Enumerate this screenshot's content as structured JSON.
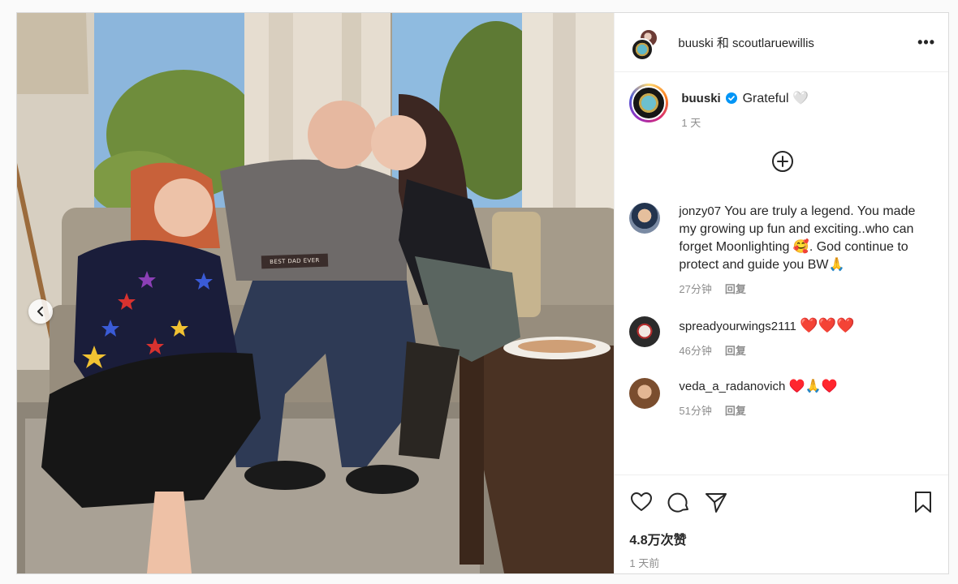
{
  "header": {
    "title": "buuski 和 scoutlaruewillis",
    "more_label": "•••"
  },
  "photo": {
    "tag_text": "BEST DAD EVER",
    "nav_prev_icon": "chevron-left-icon"
  },
  "caption": {
    "user": "buuski",
    "text": "Grateful 🤍",
    "time": "1 天",
    "verified_color": "#0095f6"
  },
  "comments": [
    {
      "user": "jonzy07",
      "text": "You are truly a legend. You made my growing up fun and exciting..who can forget Moonlighting 🥰. God continue to protect and guide you BW🙏",
      "time": "27分钟",
      "reply": "回复"
    },
    {
      "user": "spreadyourwings2111",
      "text": "❤️❤️❤️",
      "time": "46分钟",
      "reply": "回复"
    },
    {
      "user": "veda_a_radanovich",
      "text": "♥️🙏♥️",
      "time": "51分钟",
      "reply": "回复"
    }
  ],
  "actions": {
    "likes": "4.8万次赞",
    "posted": "1 天前"
  },
  "colors": {
    "accent": "#0095f6",
    "text": "#262626",
    "muted": "#8e8e8e"
  }
}
